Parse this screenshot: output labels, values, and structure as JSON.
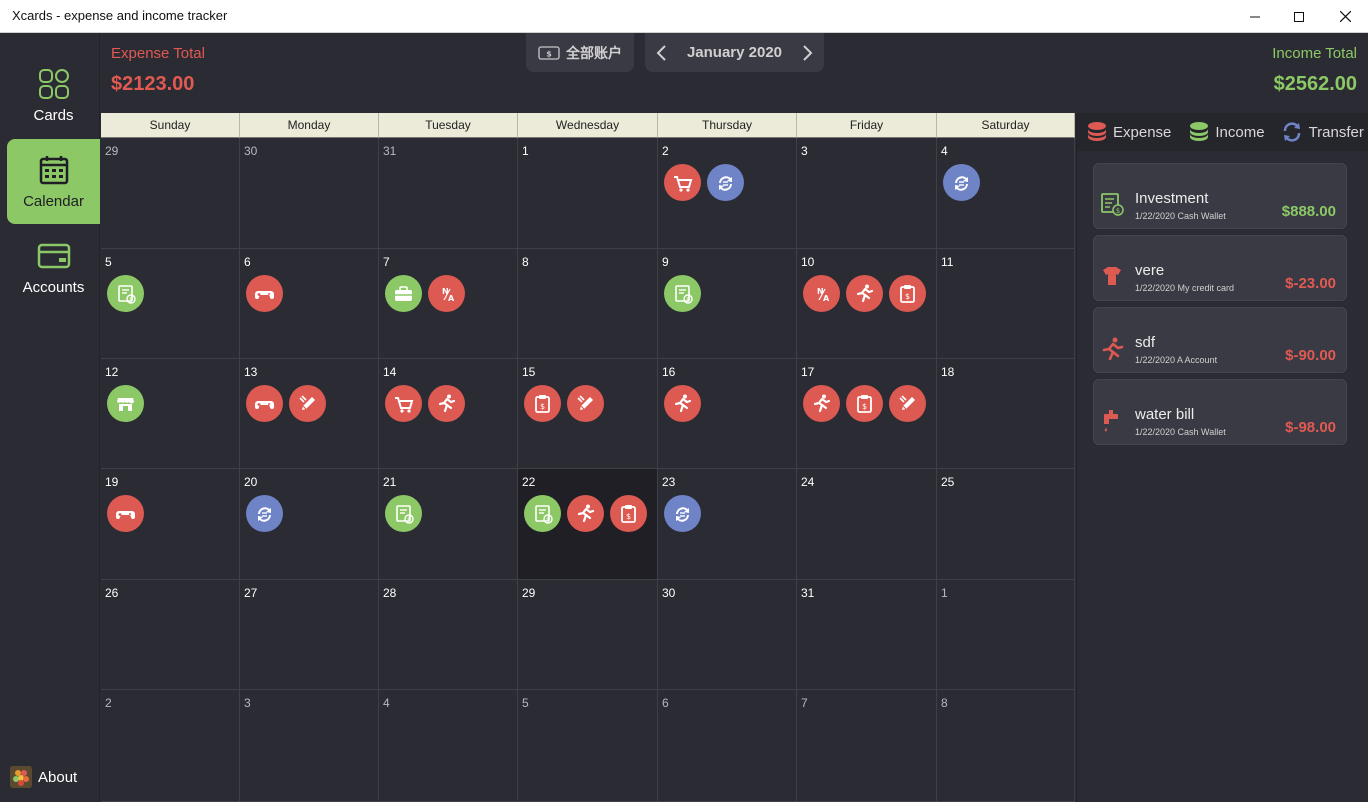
{
  "window": {
    "title": "Xcards - expense and income tracker"
  },
  "sidebar": {
    "items": [
      {
        "label": "Cards",
        "icon": "cards-icon",
        "active": false
      },
      {
        "label": "Calendar",
        "icon": "calendar-icon",
        "active": true
      },
      {
        "label": "Accounts",
        "icon": "wallet-icon",
        "active": false
      }
    ],
    "about": "About"
  },
  "header": {
    "expense_label": "Expense Total",
    "expense_total": "$2123.00",
    "income_label": "Income Total",
    "income_total": "$2562.00",
    "account_selector": "全部账户",
    "month": "January 2020"
  },
  "calendar": {
    "weekdays": [
      "Sunday",
      "Monday",
      "Tuesday",
      "Wednesday",
      "Thursday",
      "Friday",
      "Saturday"
    ],
    "selected": "22",
    "weeks": [
      [
        {
          "d": "29",
          "o": 1,
          "i": []
        },
        {
          "d": "30",
          "o": 1,
          "i": []
        },
        {
          "d": "31",
          "o": 1,
          "i": []
        },
        {
          "d": "1",
          "i": []
        },
        {
          "d": "2",
          "i": [
            [
              "r",
              "cart"
            ],
            [
              "b",
              "transfer"
            ]
          ]
        },
        {
          "d": "3",
          "i": []
        },
        {
          "d": "4",
          "i": [
            [
              "b",
              "transfer"
            ]
          ]
        }
      ],
      [
        {
          "d": "5",
          "i": [
            [
              "g",
              "bill"
            ]
          ]
        },
        {
          "d": "6",
          "i": [
            [
              "r",
              "game"
            ]
          ]
        },
        {
          "d": "7",
          "i": [
            [
              "g",
              "briefcase"
            ],
            [
              "r",
              "na"
            ]
          ]
        },
        {
          "d": "8",
          "i": []
        },
        {
          "d": "9",
          "i": [
            [
              "g",
              "bill"
            ]
          ]
        },
        {
          "d": "10",
          "i": [
            [
              "r",
              "na"
            ],
            [
              "r",
              "run"
            ],
            [
              "r",
              "clipboard"
            ]
          ]
        },
        {
          "d": "11",
          "i": []
        }
      ],
      [
        {
          "d": "12",
          "i": [
            [
              "g",
              "shop"
            ]
          ]
        },
        {
          "d": "13",
          "i": [
            [
              "r",
              "game"
            ],
            [
              "r",
              "pencil"
            ]
          ]
        },
        {
          "d": "14",
          "i": [
            [
              "r",
              "cart"
            ],
            [
              "r",
              "run"
            ]
          ]
        },
        {
          "d": "15",
          "i": [
            [
              "r",
              "clipboard"
            ],
            [
              "r",
              "pencil"
            ]
          ]
        },
        {
          "d": "16",
          "i": [
            [
              "r",
              "run"
            ]
          ]
        },
        {
          "d": "17",
          "i": [
            [
              "r",
              "run"
            ],
            [
              "r",
              "clipboard"
            ],
            [
              "r",
              "pencil"
            ]
          ]
        },
        {
          "d": "18",
          "i": []
        }
      ],
      [
        {
          "d": "19",
          "i": [
            [
              "r",
              "game"
            ]
          ]
        },
        {
          "d": "20",
          "i": [
            [
              "b",
              "transfer"
            ]
          ]
        },
        {
          "d": "21",
          "i": [
            [
              "g",
              "bill"
            ]
          ]
        },
        {
          "d": "22",
          "sel": 1,
          "i": [
            [
              "g",
              "bill"
            ],
            [
              "r",
              "run"
            ],
            [
              "r",
              "clipboard"
            ]
          ]
        },
        {
          "d": "23",
          "i": [
            [
              "b",
              "transfer"
            ]
          ]
        },
        {
          "d": "24",
          "i": []
        },
        {
          "d": "25",
          "i": []
        }
      ],
      [
        {
          "d": "26",
          "i": []
        },
        {
          "d": "27",
          "i": []
        },
        {
          "d": "28",
          "i": []
        },
        {
          "d": "29",
          "i": []
        },
        {
          "d": "30",
          "i": []
        },
        {
          "d": "31",
          "i": []
        },
        {
          "d": "1",
          "o": 1,
          "i": []
        }
      ],
      [
        {
          "d": "2",
          "o": 1,
          "i": []
        },
        {
          "d": "3",
          "o": 1,
          "i": []
        },
        {
          "d": "4",
          "o": 1,
          "i": []
        },
        {
          "d": "5",
          "o": 1,
          "i": []
        },
        {
          "d": "6",
          "o": 1,
          "i": []
        },
        {
          "d": "7",
          "o": 1,
          "i": []
        },
        {
          "d": "8",
          "o": 1,
          "i": []
        }
      ]
    ]
  },
  "panel": {
    "tabs": [
      {
        "label": "Expense",
        "icon": "coin-stack-icon",
        "color": "#dc5a52"
      },
      {
        "label": "Income",
        "icon": "coin-stack-icon",
        "color": "#8cc866"
      },
      {
        "label": "Transfer",
        "icon": "transfer-icon",
        "color": "#6f84c7"
      }
    ],
    "transactions": [
      {
        "name": "Investment",
        "date": "1/22/2020",
        "account": "Cash Wallet",
        "amount": "$888.00",
        "kind": "income",
        "icon": "bill-icon"
      },
      {
        "name": "vere",
        "date": "1/22/2020",
        "account": "My credit card",
        "amount": "$-23.00",
        "kind": "expense",
        "icon": "shirt-icon"
      },
      {
        "name": "sdf",
        "date": "1/22/2020",
        "account": "A Account",
        "amount": "$-90.00",
        "kind": "expense",
        "icon": "run-icon"
      },
      {
        "name": "water bill",
        "date": "1/22/2020",
        "account": "Cash Wallet",
        "amount": "$-98.00",
        "kind": "expense",
        "icon": "faucet-icon"
      }
    ]
  },
  "colors": {
    "expense": "#e05a52",
    "income": "#8cc866",
    "transfer": "#6f84c7",
    "background": "#2b2b33"
  }
}
